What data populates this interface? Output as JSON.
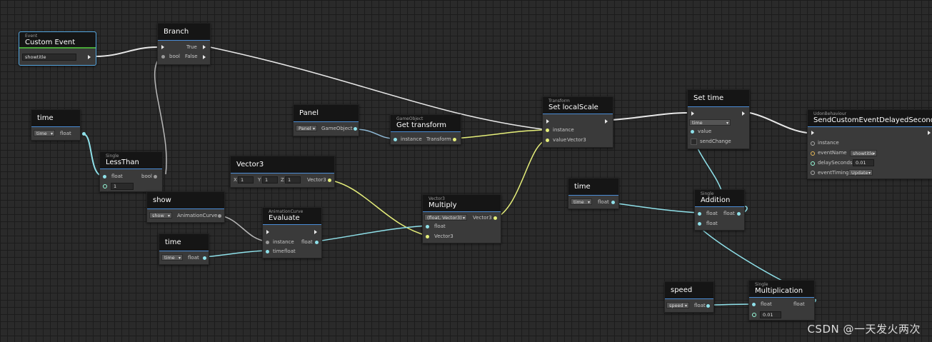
{
  "colors": {
    "flow": "#e8e8e8",
    "float": "#8fe1ea",
    "vector": "#e6ef7a",
    "object": "#8fb8d4",
    "select": "#55a6e0"
  },
  "nodes": {
    "custom_event": {
      "subtitle": "Event",
      "title": "Custom Event",
      "field": "showtitle"
    },
    "branch": {
      "title": "Branch",
      "true_label": "True",
      "bool_label": "bool",
      "false_label": "False"
    },
    "time1": {
      "title": "time",
      "dropdown": "time",
      "out": "float"
    },
    "lessthan": {
      "subtitle": "Single",
      "title": "LessThan",
      "in_float": "float",
      "out_bool": "bool",
      "value": "1"
    },
    "panel": {
      "title": "Panel",
      "dropdown": "Panel",
      "out": "GameObject"
    },
    "get_transform": {
      "subtitle": "GameObject",
      "title": "Get transform",
      "in": "instance",
      "out": "Transform"
    },
    "vector3": {
      "title": "Vector3",
      "x_label": "X",
      "x": "1",
      "y_label": "Y",
      "y": "1",
      "z_label": "Z",
      "z": "1",
      "out": "Vector3"
    },
    "show": {
      "title": "show",
      "dropdown": "show",
      "out": "AnimationCurve"
    },
    "evaluate": {
      "subtitle": "AnimationCurve",
      "title": "Evaluate",
      "in_instance": "instance",
      "in_time": "time",
      "out": "float",
      "out_float": "float"
    },
    "time2": {
      "title": "time",
      "dropdown": "time",
      "out": "float"
    },
    "multiply": {
      "subtitle": "Vector3",
      "title": "Multiply",
      "dropdown": "(float, Vector3)",
      "in_float": "float",
      "in_vec": "Vector3",
      "out": "Vector3"
    },
    "set_local_scale": {
      "subtitle": "Transform",
      "title": "Set localScale",
      "in_instance": "instance",
      "in_value": "value",
      "in_value_type": "Vector3"
    },
    "set_time": {
      "title": "Set time",
      "dropdown": "time",
      "in_value": "value",
      "send_change": "sendChange"
    },
    "time3": {
      "title": "time",
      "dropdown": "time",
      "out": "float"
    },
    "addition": {
      "subtitle": "Single",
      "title": "Addition",
      "in_a": "float",
      "in_b": "float",
      "out": "float"
    },
    "speed": {
      "title": "speed",
      "dropdown": "speed",
      "out": "float"
    },
    "multiplication": {
      "subtitle": "Single",
      "title": "Multiplication",
      "in_a": "float",
      "out": "float",
      "value": "0.01"
    },
    "send_custom": {
      "subtitle": "UdonBehaviour",
      "title": "SendCustomEventDelayedSeconds",
      "instance": "instance",
      "event_name": "eventName",
      "event_name_value": "showtitle",
      "delay": "delaySeconds",
      "delay_value": "0.01",
      "timing": "eventTiming",
      "timing_value": "Update"
    }
  },
  "watermark": "CSDN @一天发火两次"
}
